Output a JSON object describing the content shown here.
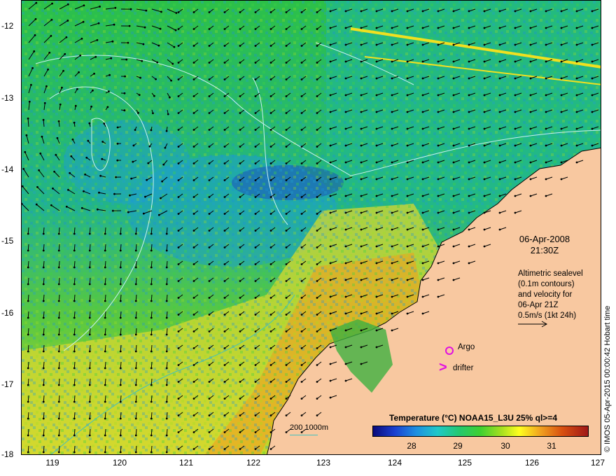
{
  "map": {
    "y_ticks": [
      "-12",
      "-13",
      "-14",
      "-15",
      "-16",
      "-17",
      "-18"
    ],
    "x_ticks": [
      "119",
      "120",
      "121",
      "122",
      "123",
      "124",
      "125",
      "126",
      "127"
    ],
    "date_line1": "06-Apr-2008",
    "date_line2": "21:30Z",
    "altimetry_lines": [
      "Altimetric sealevel",
      "(0.1m contours)",
      "and velocity for",
      "06-Apr 21Z",
      "0.5m/s (1kt 24h)"
    ],
    "argo_label": "Argo",
    "drifter_label": "drifter",
    "drifter_symbol": ">",
    "bathy_label": "200  1000m",
    "colorbar_title": "Temperature (°C) NOAA15_L3U 25% ql>=4",
    "colorbar_ticks": [
      "28",
      "29",
      "30",
      "31"
    ],
    "credit": "© IMOS 05-Apr-2015 00:00:42 Hobart time",
    "colors": {
      "land": "#f8c8a0",
      "argo_marker": "#e010e0",
      "drifter_marker": "#e010e0",
      "contour": "#c8f0f0",
      "bathy": "#40c0c0",
      "vectors": "#000000"
    }
  }
}
